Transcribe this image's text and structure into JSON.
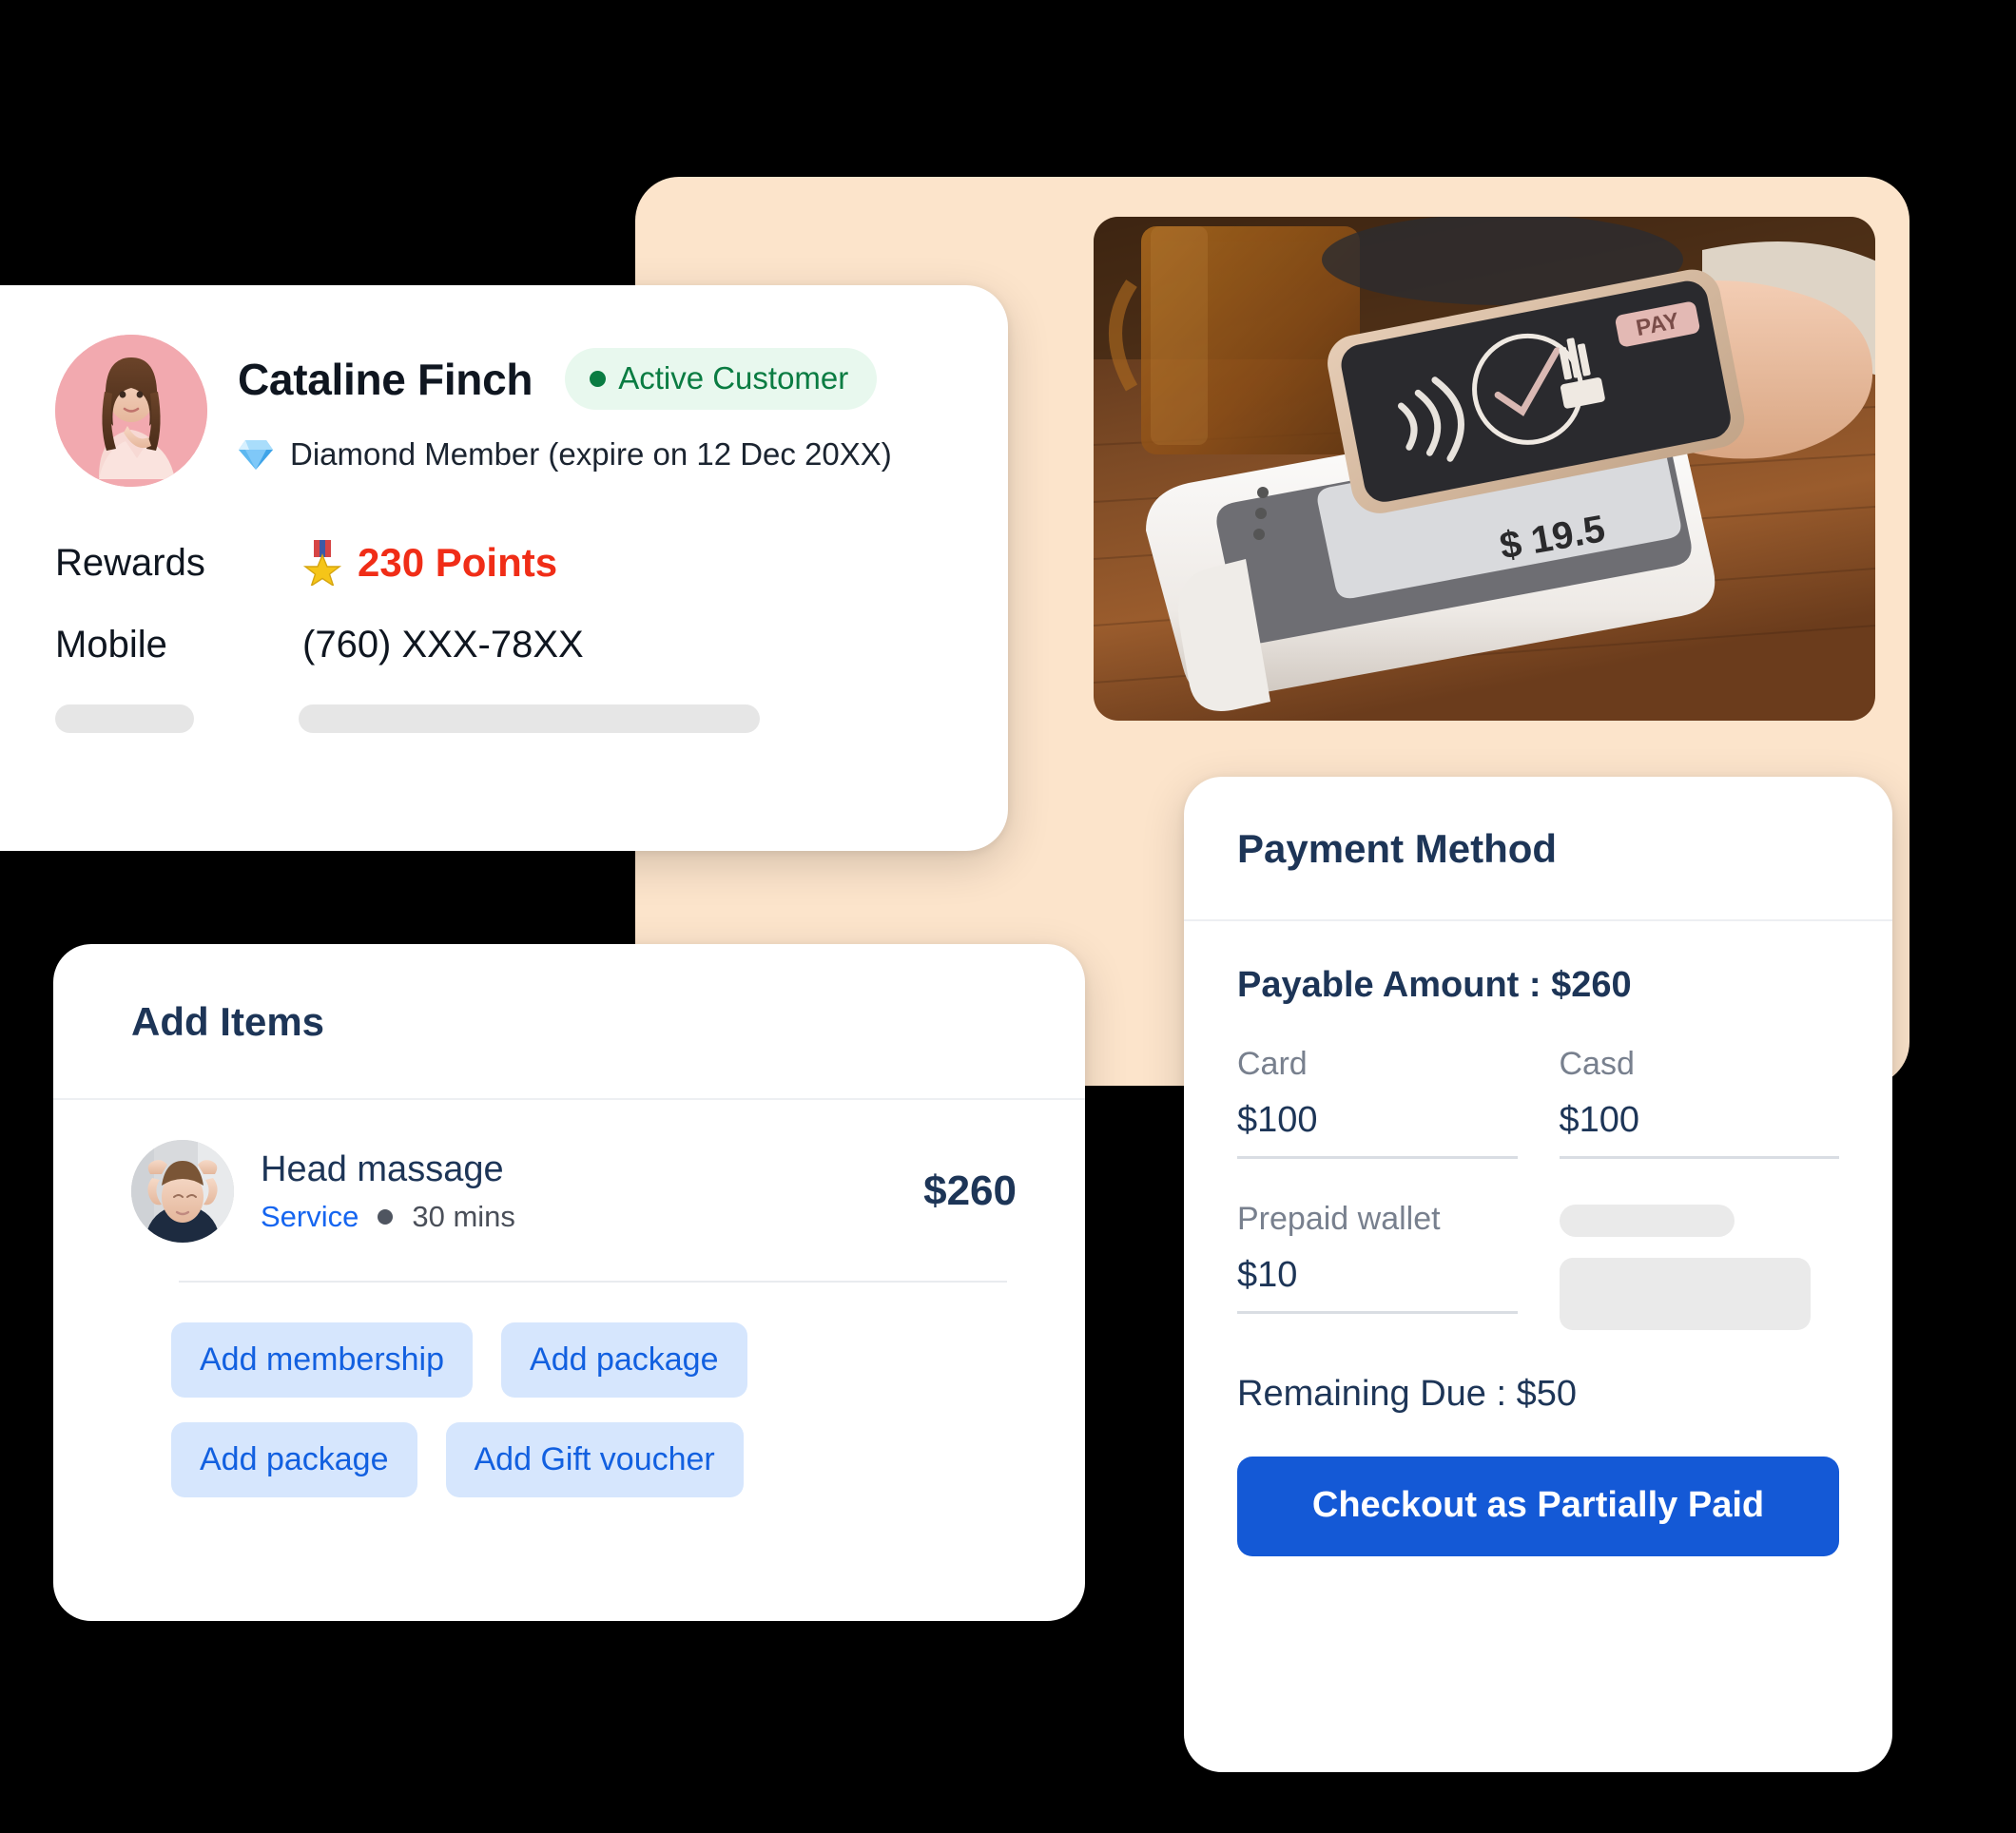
{
  "theme": {
    "backdrop_color": "#FCE4CB",
    "card_background": "#FFFFFF",
    "heading_color": "#1D3557",
    "accent_blue": "#1459D6",
    "chip_background": "#D6E6FD",
    "chip_text": "#1260E0",
    "points_color": "#F02D17",
    "badge_background": "#E8F8EE",
    "badge_text": "#0A7C42",
    "muted_text": "#78808E",
    "skeleton_color": "#E6E6E6"
  },
  "profile": {
    "avatar_icon": "customer-avatar-photo",
    "customer_name": "Cataline Finch",
    "status_badge": {
      "dot_icon": "status-dot-icon",
      "label": "Active Customer"
    },
    "membership": {
      "icon": "diamond-gem-icon",
      "text": "Diamond Member (expire on 12 Dec 20XX)"
    },
    "details": [
      {
        "key": "Rewards",
        "value": "230 Points",
        "icon": "medal-icon",
        "highlight": true
      },
      {
        "key": "Mobile",
        "value": "(760) XXX-78XX",
        "icon": "",
        "highlight": false
      }
    ],
    "skeleton_rows": 2
  },
  "hero": {
    "image_icon": "contactless-payment-photo",
    "alt": "Hand tapping a smartphone on a white card payment terminal on a wooden table"
  },
  "add_items": {
    "title": "Add Items",
    "item": {
      "thumbnail_icon": "head-massage-service-photo",
      "name": "Head massage",
      "tag": "Service",
      "separator_icon": "bullet-dot-icon",
      "duration": "30 mins",
      "price": "$260"
    },
    "chips": [
      {
        "label": "Add membership",
        "name": "add-membership-chip"
      },
      {
        "label": "Add package",
        "name": "add-package-chip-1"
      },
      {
        "label": "Add package",
        "name": "add-package-chip-2"
      },
      {
        "label": "Add Gift voucher",
        "name": "add-gift-voucher-chip"
      }
    ]
  },
  "payment": {
    "title": "Payment Method",
    "payable_amount_label": "Payable Amount : $260",
    "fields": [
      {
        "label": "Card",
        "value": "$100",
        "name": "card-amount-field"
      },
      {
        "label": "Casd",
        "value": "$100",
        "name": "cash-amount-field"
      },
      {
        "label": "Prepaid wallet",
        "value": "$10",
        "name": "prepaid-wallet-amount-field"
      }
    ],
    "placeholder_field": {
      "label_is_skeleton": true,
      "input_is_skeleton": true
    },
    "remaining_due_label": "Remaining Due : $50",
    "checkout_button_label": "Checkout as Partially Paid"
  }
}
